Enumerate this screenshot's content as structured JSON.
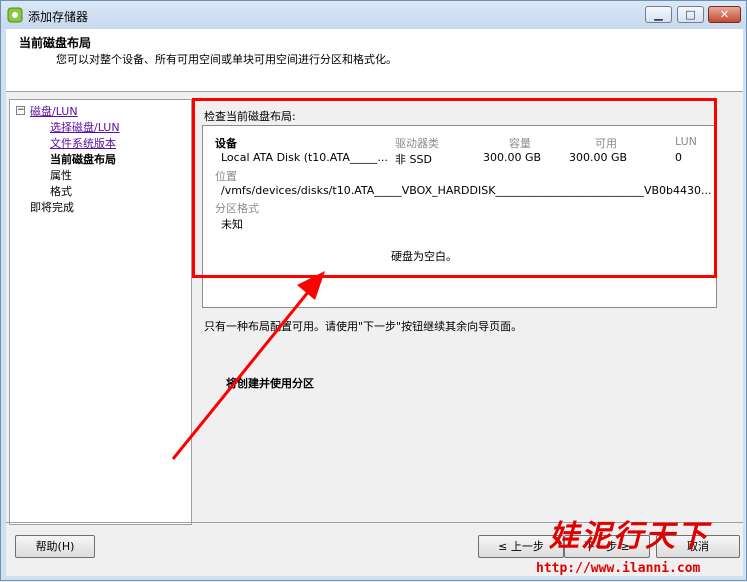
{
  "window": {
    "title": "添加存储器",
    "controls": {
      "minimize": "▁",
      "maximize": "□",
      "close": "✕"
    }
  },
  "header": {
    "title": "当前磁盘布局",
    "subtitle": "您可以对整个设备、所有可用空间或单块可用空间进行分区和格式化。"
  },
  "nav": {
    "collapse_symbol": "−",
    "items": [
      {
        "label": "磁盘/LUN",
        "link": true
      },
      {
        "label": "选择磁盘/LUN",
        "link": true
      },
      {
        "label": "文件系统版本",
        "link": true
      },
      {
        "label": "当前磁盘布局",
        "current": true
      },
      {
        "label": "属性"
      },
      {
        "label": "格式"
      },
      {
        "label": "即将完成"
      }
    ]
  },
  "main": {
    "review_label": "检查当前磁盘布局:",
    "columns": {
      "device": "设备",
      "drive_type": "驱动器类",
      "capacity": "容量",
      "available": "可用",
      "lun": "LUN"
    },
    "row": {
      "device": "Local ATA Disk (t10.ATA_____...",
      "drive_type": "非 SSD",
      "capacity": "300.00 GB",
      "available": "300.00 GB",
      "lun": "0"
    },
    "location_label": "位置",
    "location_value": "/vmfs/devices/disks/t10.ATA_____VBOX_HARDDISK___________________________VB0b4430...",
    "partition_label": "分区格式",
    "partition_value": "未知",
    "empty_message": "硬盘为空白。",
    "note": "只有一种布局配置可用。请使用\"下一步\"按钮继续其余向导页面。",
    "create_partition": "将创建并使用分区"
  },
  "footer": {
    "help": "帮助(H)",
    "back": "≤ 上一步",
    "next": "下一步 ≥",
    "cancel": "取消"
  },
  "watermark": {
    "text": "娃泥行天下",
    "url": "http://www.ilanni.com"
  },
  "colors": {
    "highlight": "#ff0000",
    "link": "#5b0fa0"
  }
}
